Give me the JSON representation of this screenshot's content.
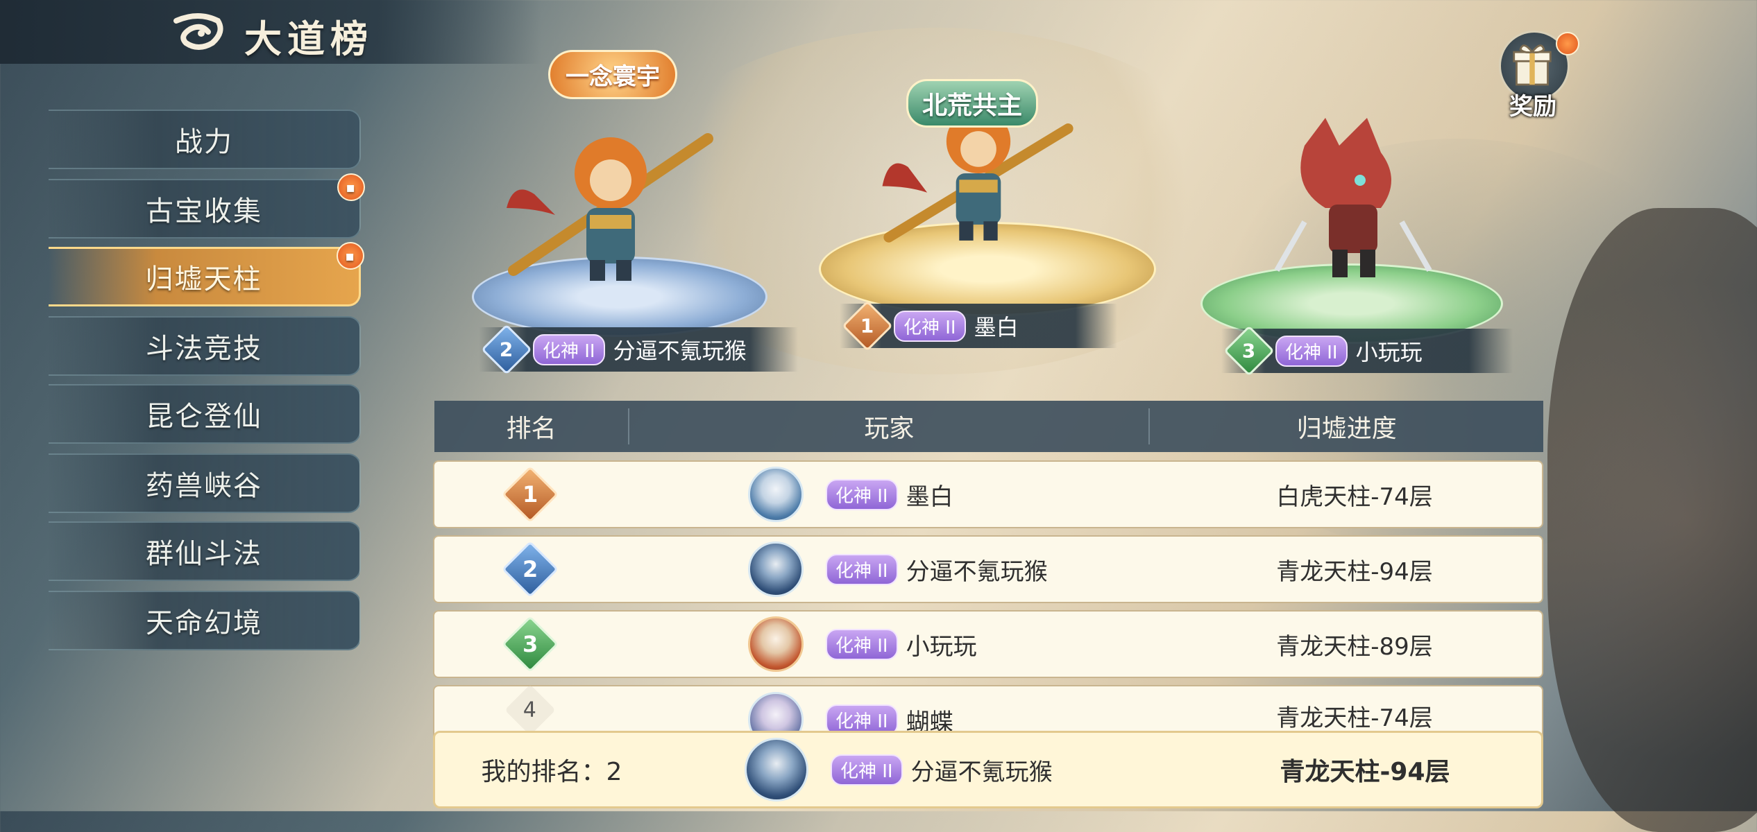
{
  "header": {
    "title": "大道榜"
  },
  "sidebar": {
    "items": [
      {
        "label": "战力",
        "active": false,
        "gift": false
      },
      {
        "label": "古宝收集",
        "active": false,
        "gift": true
      },
      {
        "label": "归墟天柱",
        "active": true,
        "gift": true
      },
      {
        "label": "斗法竞技",
        "active": false,
        "gift": false
      },
      {
        "label": "昆仑登仙",
        "active": false,
        "gift": false
      },
      {
        "label": "药兽峡谷",
        "active": false,
        "gift": false
      },
      {
        "label": "群仙斗法",
        "active": false,
        "gift": false
      },
      {
        "label": "天命幻境",
        "active": false,
        "gift": false
      }
    ]
  },
  "reward": {
    "label": "奖励"
  },
  "podium": {
    "first": {
      "rank": "1",
      "realm": "化神 II",
      "name": "墨白",
      "title": "北荒共主"
    },
    "second": {
      "rank": "2",
      "realm": "化神 II",
      "name": "分逼不氪玩猴",
      "title": "一念寰宇"
    },
    "third": {
      "rank": "3",
      "realm": "化神 II",
      "name": "小玩玩"
    }
  },
  "table": {
    "headers": [
      "排名",
      "玩家",
      "归墟进度"
    ],
    "rows": [
      {
        "rank": "1",
        "realm": "化神 II",
        "name": "墨白",
        "progress": "白虎天柱-74层"
      },
      {
        "rank": "2",
        "realm": "化神 II",
        "name": "分逼不氪玩猴",
        "progress": "青龙天柱-94层"
      },
      {
        "rank": "3",
        "realm": "化神 II",
        "name": "小玩玩",
        "progress": "青龙天柱-89层"
      },
      {
        "rank": "4",
        "realm": "化神 II",
        "name": "蝴蝶",
        "progress": "青龙天柱-74层"
      }
    ]
  },
  "my_rank": {
    "label": "我的排名：2",
    "realm": "化神 II",
    "name": "分逼不氪玩猴",
    "progress": "青龙天柱-94层"
  },
  "colors": {
    "gold": "#c98a3e",
    "silver": "#3f74b8",
    "bronze": "#3f9a4f",
    "realm": "#8f66d6"
  }
}
